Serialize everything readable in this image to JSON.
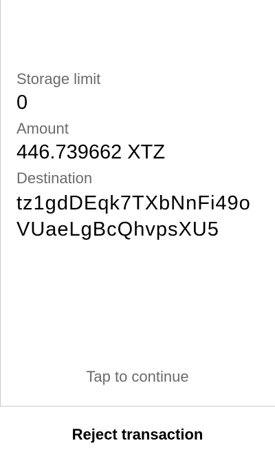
{
  "fields": {
    "storage_limit": {
      "label": "Storage limit",
      "value": "0"
    },
    "amount": {
      "label": "Amount",
      "value": "446.739662 XTZ"
    },
    "destination": {
      "label": "Destination",
      "value": "tz1gdDEqk7TXbNnFi49oVUaeLgBcQhvpsXU5"
    }
  },
  "footer": {
    "tap_hint": "Tap to continue",
    "reject_label": "Reject transaction"
  },
  "colors": {
    "label": "#6b6b6b",
    "value": "#000000",
    "divider": "#c9c9c9",
    "background": "#ffffff"
  }
}
